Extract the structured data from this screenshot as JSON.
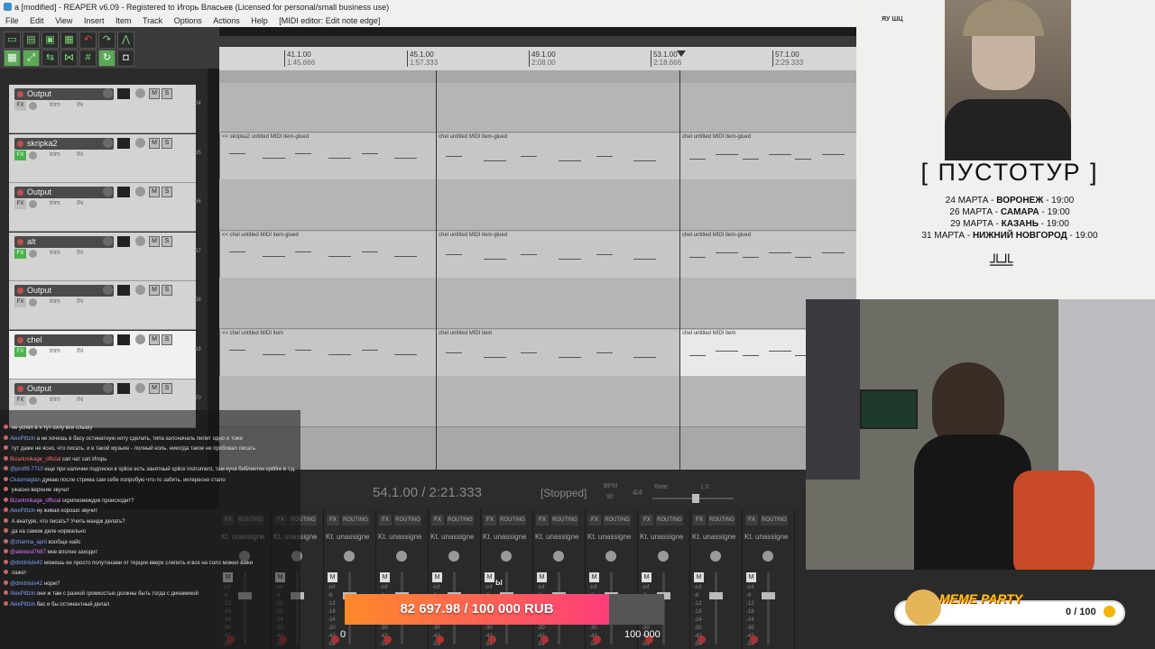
{
  "window": {
    "title": "a [modified] - REAPER v6.09 - Registered to Игорь Власьев (Licensed for personal/small business use)",
    "menu": [
      "File",
      "Edit",
      "View",
      "Insert",
      "Item",
      "Track",
      "Options",
      "Actions",
      "Help",
      "[MIDI editor: Edit note edge]"
    ]
  },
  "toolbar": {
    "icons": [
      "save-icon",
      "undo-icon",
      "redo-icon",
      "metronome-icon",
      "grid-icon",
      "snap-icon",
      "lock-icon"
    ]
  },
  "ruler": {
    "marks": [
      {
        "bar": "41.1.00",
        "time": "1:45.666"
      },
      {
        "bar": "45.1.00",
        "time": "1:57.333"
      },
      {
        "bar": "49.1.00",
        "time": "2:08.00"
      },
      {
        "bar": "53.1.00",
        "time": "2:18.666"
      },
      {
        "bar": "57.1.00",
        "time": "2:29.333"
      }
    ]
  },
  "tracks": [
    {
      "name": "Output",
      "num": "64",
      "sel": false,
      "fx_on": false
    },
    {
      "name": "skripka2",
      "num": "65",
      "sel": false,
      "fx_on": true
    },
    {
      "name": "Output",
      "num": "66",
      "sel": false,
      "fx_on": false
    },
    {
      "name": "alt",
      "num": "67",
      "sel": false,
      "fx_on": true
    },
    {
      "name": "Output",
      "num": "68",
      "sel": false,
      "fx_on": false
    },
    {
      "name": "chel",
      "num": "69",
      "sel": true,
      "fx_on": true
    },
    {
      "name": "Output",
      "num": "70",
      "sel": false,
      "fx_on": false
    }
  ],
  "track_labels": {
    "fx": "FX",
    "trim": "trim",
    "in": "IN",
    "m": "M",
    "s": "S"
  },
  "items": {
    "skripka2": [
      "<< skripka2 untitled MIDI item-glued",
      "chel untitled MIDI item-glued",
      "chel untitled MIDI item-glued"
    ],
    "alt": [
      "<< chel untitled MIDI item-glued",
      "chel untitled MIDI item-glued",
      "chel untitled MIDI item-glued"
    ],
    "chel": [
      "<< chel untitled MIDI item",
      "chel untitled MIDI item",
      "chel untitled MIDI item"
    ]
  },
  "transport": {
    "position": "54.1.00 / 2:21.333",
    "status": "[Stopped]",
    "bpm_label": "BPM",
    "bpm": "90",
    "timesig": "4/4",
    "rate_label": "Rate:",
    "rate": "1.0"
  },
  "mixer": {
    "fx_label": "FX",
    "routing_label": "ROUTING",
    "strip_label": "Kt. unassigne",
    "db_ticks": [
      "-inf",
      "-6",
      "-12",
      "-18",
      "-24",
      "-30",
      "-42",
      "-54"
    ],
    "m": "M",
    "s": "S"
  },
  "chat": [
    {
      "user": "",
      "msg": "не успел в х тут силу все слышу",
      "uc": "u"
    },
    {
      "user": "AlexPittzin",
      "msg": "а не хочешь в басу остинатную ноту сделать, типа аэлоначаль пилит одно и тоже",
      "uc": "u"
    },
    {
      "user": "",
      "msg": "тут даже не ясно, что писать. и в такой музыке - полный ноль. никогда такое не пробовал писать",
      "uc": "u2"
    },
    {
      "user": "Bizarkmikage_official",
      "msg": "сап чат сап Игорь",
      "uc": "u3"
    },
    {
      "user": "@pruftft-7710",
      "msg": "еще при наличии подписки в splice есть занятный splice instrument, там куча библиотек spitfire в т.д.",
      "uc": "u"
    },
    {
      "user": "Ckaomagtan",
      "msg": "думаю после стрима сам себе попробую что-то забить. интересно стало",
      "uc": "u"
    },
    {
      "user": "",
      "msg": "ужасно верхние звучат",
      "uc": "u"
    },
    {
      "user": "Bizarkmikage_official",
      "msg": "скрипкомеждик происходит?",
      "uc": "u2"
    },
    {
      "user": "AlexPittzin",
      "msg": "ну живая хорошо звучит",
      "uc": "u"
    },
    {
      "user": "",
      "msg": "А внатуре, что писать? Учить мандж делать?",
      "uc": "u"
    },
    {
      "user": "",
      "msg": "да на самом деле нормально",
      "uc": "u"
    },
    {
      "user": "@zharma_april",
      "msg": "вообще найс",
      "uc": "u"
    },
    {
      "user": "@alexiest7687",
      "msg": "мне вполне заходит",
      "uc": "u2"
    },
    {
      "user": "@dmitriislv42",
      "msg": "можешь ее просто полутонами от терции вверх слепить и все на соло можно важи",
      "uc": "u"
    },
    {
      "user": "",
      "msg": "лажет",
      "uc": "u"
    },
    {
      "user": "@dmitriislv42",
      "msg": "норм?",
      "uc": "u"
    },
    {
      "user": "AlexPittzin",
      "msg": "они ж там с разной громкостью должны быть тогда с динамикой",
      "uc": "u"
    },
    {
      "user": "AlexPittzin",
      "msg": "бас и бы остинантный делал",
      "uc": "u"
    }
  ],
  "poster": {
    "logo_text": "ЯУ ШЦ",
    "title": "[ ПУСТОТУР ]",
    "dates": [
      {
        "date": "24 МАРТА",
        "city": "ВОРОНЕЖ",
        "time": "19:00"
      },
      {
        "date": "26 МАРТА",
        "city": "САМАРА",
        "time": "19:00"
      },
      {
        "date": "29 МАРТА",
        "city": "КАЗАНЬ",
        "time": "19:00"
      },
      {
        "date": "31 МАРТА",
        "city": "НИЖНИЙ НОВГОРОД",
        "time": "19:00"
      }
    ],
    "separator": " - "
  },
  "donation": {
    "text": "82 697.98 / 100 000 RUB",
    "min": "0",
    "max": "100 000",
    "stray": "ы",
    "progress": 0.827
  },
  "meme_party": {
    "title": "MEME PARTY",
    "count": "0 / 100"
  },
  "colors": {
    "accent": "#49b34a",
    "donation_start": "#ff8a2a",
    "donation_end": "#ff3d7a",
    "rec": "#c0504d"
  }
}
